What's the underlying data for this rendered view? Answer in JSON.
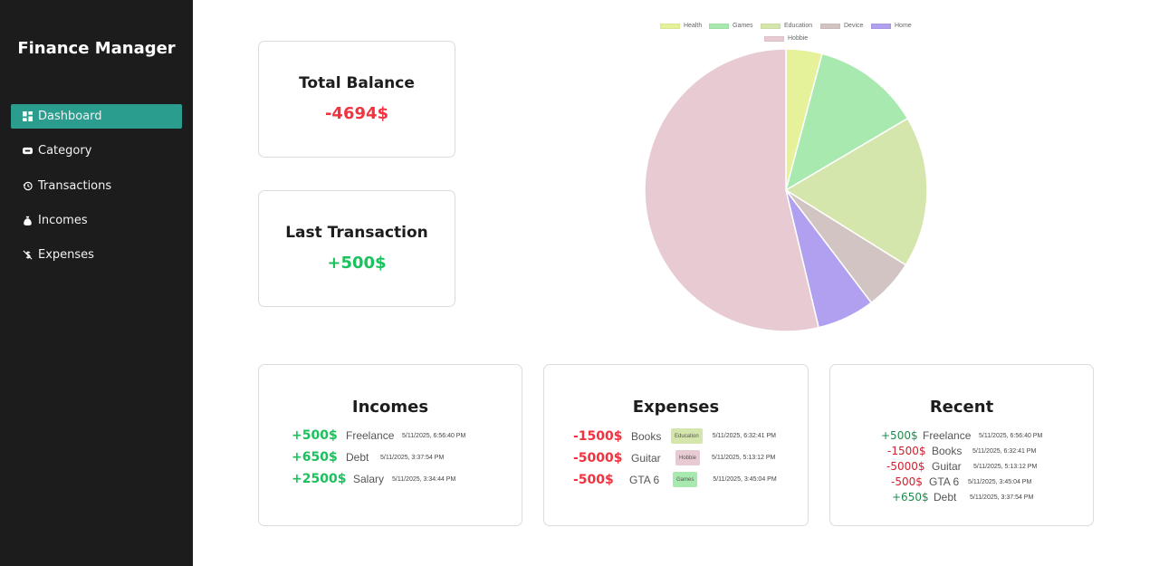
{
  "sidebar": {
    "brand": "Finance Manager",
    "items": [
      {
        "label": "Dashboard",
        "icon": "dashboard-icon"
      },
      {
        "label": "Category",
        "icon": "category-icon"
      },
      {
        "label": "Transactions",
        "icon": "history-icon"
      },
      {
        "label": "Incomes",
        "icon": "money-bag-icon"
      },
      {
        "label": "Expenses",
        "icon": "expense-icon"
      }
    ],
    "active": "Dashboard"
  },
  "stats": {
    "balance": {
      "title": "Total Balance",
      "value": "-4694$"
    },
    "last": {
      "title": "Last Transaction",
      "value": "+500$"
    }
  },
  "chart_data": {
    "type": "pie",
    "title": "",
    "labels": [
      "Health",
      "Games",
      "Education",
      "Device",
      "Home",
      "Hobbie"
    ],
    "values": [
      500,
      1500,
      2100,
      700,
      800,
      6500
    ],
    "colors": [
      "#e6f299",
      "#a8e9b0",
      "#d4e6ab",
      "#d3c4c4",
      "#b0a0ef",
      "#e8cbd2"
    ],
    "legend_position": "top"
  },
  "incomes": {
    "title": "Incomes",
    "rows": [
      {
        "amount": "+500$",
        "name": "Freelance",
        "time": "5/11/2025, 6:56:40 PM"
      },
      {
        "amount": "+650$",
        "name": "Debt",
        "time": "5/11/2025, 3:37:54 PM"
      },
      {
        "amount": "+2500$",
        "name": "Salary",
        "time": "5/11/2025, 3:34:44 PM"
      }
    ]
  },
  "expenses": {
    "title": "Expenses",
    "rows": [
      {
        "amount": "-1500$",
        "name": "Books",
        "tag": "Education",
        "tag_color": "#d4e6ab",
        "time": "5/11/2025, 6:32:41 PM"
      },
      {
        "amount": "-5000$",
        "name": "Guitar",
        "tag": "Hobbie",
        "tag_color": "#e8cbd2",
        "time": "5/11/2025, 5:13:12 PM"
      },
      {
        "amount": "-500$",
        "name": "GTA 6",
        "tag": "Games",
        "tag_color": "#a8e9b0",
        "time": "5/11/2025, 3:45:04 PM"
      }
    ]
  },
  "recent": {
    "title": "Recent",
    "rows": [
      {
        "amount": "+500$",
        "name": "Freelance",
        "time": "5/11/2025, 6:56:40 PM",
        "kind": "pos"
      },
      {
        "amount": "-1500$",
        "name": "Books",
        "time": "5/11/2025, 6:32:41 PM",
        "kind": "neg"
      },
      {
        "amount": "-5000$",
        "name": "Guitar",
        "time": "5/11/2025, 5:13:12 PM",
        "kind": "neg"
      },
      {
        "amount": "-500$",
        "name": "GTA 6",
        "time": "5/11/2025, 3:45:04 PM",
        "kind": "neg"
      },
      {
        "amount": "+650$",
        "name": "Debt",
        "time": "5/11/2025, 3:37:54 PM",
        "kind": "pos"
      }
    ]
  }
}
